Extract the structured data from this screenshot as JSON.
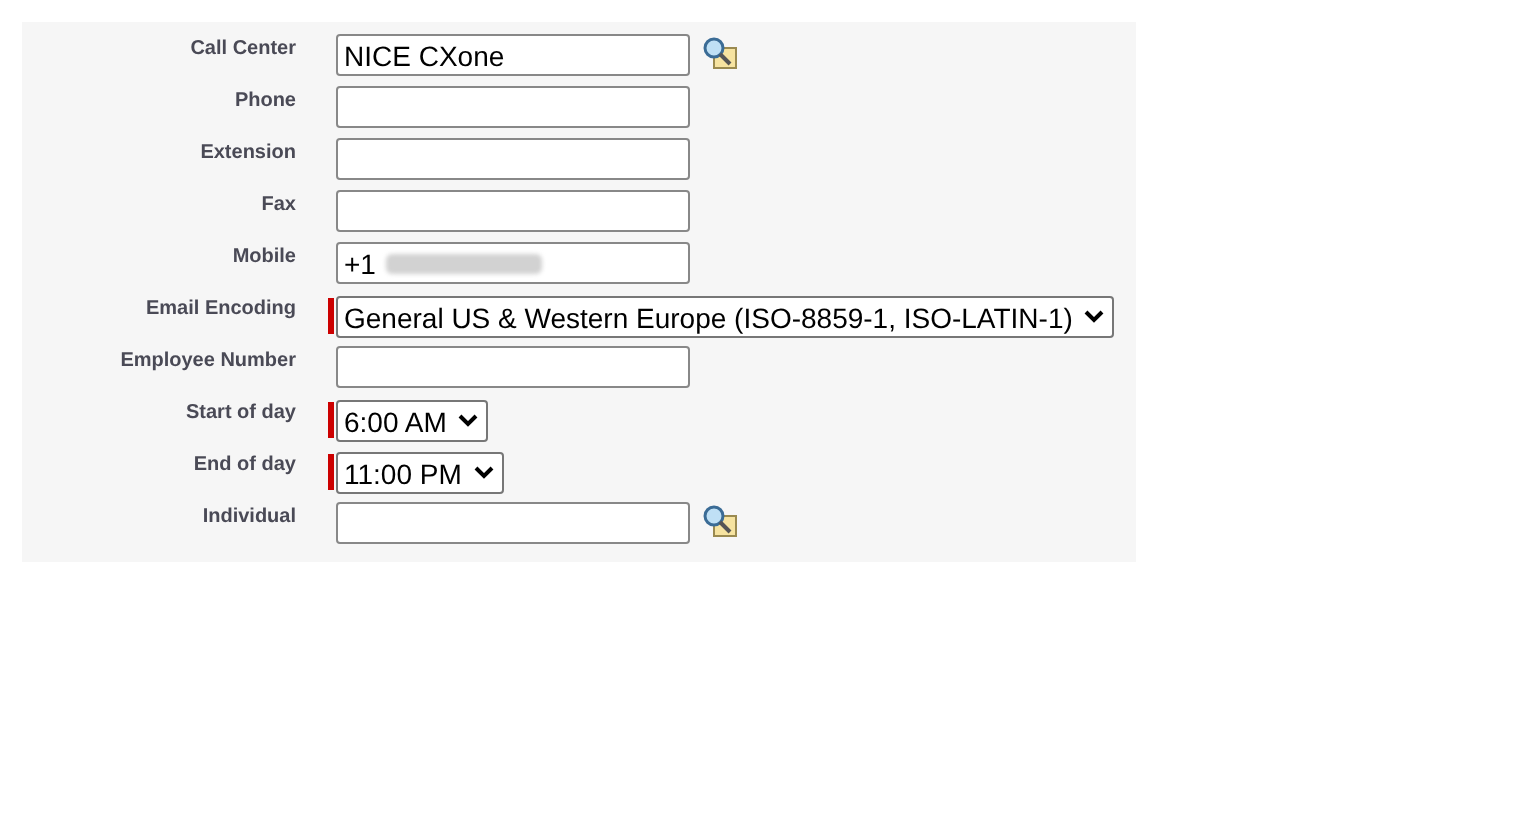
{
  "fields": [
    {
      "label": "Call Center",
      "kind": "lookup",
      "value": "NICE CXone",
      "required": false
    },
    {
      "label": "Phone",
      "kind": "text",
      "required": false
    },
    {
      "label": "Extension",
      "kind": "text",
      "required": false
    },
    {
      "label": "Fax",
      "kind": "text",
      "required": false
    },
    {
      "label": "Mobile",
      "kind": "redacted",
      "value": "+1",
      "required": false
    },
    {
      "label": "Email Encoding",
      "kind": "select",
      "value": "General US & Western Europe (ISO-8859-1, ISO-LATIN-1)",
      "required": true
    },
    {
      "label": "Employee Number",
      "kind": "text",
      "required": false
    },
    {
      "label": "Start of day",
      "kind": "select",
      "value": "6:00 AM",
      "required": true
    },
    {
      "label": "End of day",
      "kind": "select",
      "value": "11:00 PM",
      "required": true
    },
    {
      "label": "Individual",
      "kind": "lookup",
      "required": false
    }
  ]
}
